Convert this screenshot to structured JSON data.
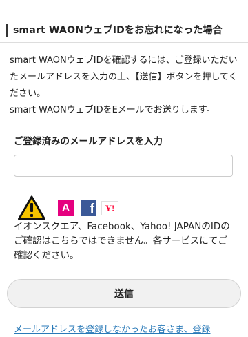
{
  "header": {
    "title": "smart WAONウェブIDをお忘れになった場合"
  },
  "description": {
    "line1": "smart WAONウェブIDを確認するには、ご登録いただいたメールアドレスを入力の上、【送信】ボタンを押してください。",
    "line2": "smart WAONウェブIDをEメールでお送りします。"
  },
  "form": {
    "email_label": "ご登録済みのメールアドレスを入力",
    "email_value": "",
    "email_placeholder": ""
  },
  "notice": {
    "icons": [
      "warning-icon",
      "aeon-square-icon",
      "facebook-icon",
      "yahoo-japan-icon"
    ],
    "icon_texts": {
      "aeon": "A",
      "facebook": "f",
      "yahoo": "Y!"
    },
    "colors": {
      "warning": "#f5c400",
      "aeon": "#e5007f",
      "facebook": "#3b5998",
      "yahoo": "#ff0033"
    },
    "text": "イオンスクエア、Facebook、Yahoo! JAPANのIDのご確認はこちらではできません。各サービスにてご確認ください。"
  },
  "actions": {
    "submit_label": "送信"
  },
  "footer": {
    "link_text": "メールアドレスを登録しなかったお客さま、登録"
  }
}
